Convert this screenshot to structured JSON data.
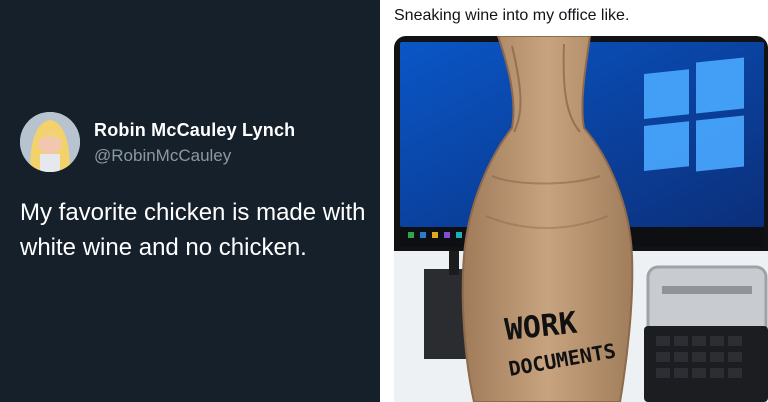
{
  "left_tweet": {
    "author_name": "Robin McCauley Lynch",
    "author_handle": "@RobinMcCauley",
    "text": "My favorite chicken is made with white wine and no chicken."
  },
  "right_tweet": {
    "caption": "Sneaking wine into my office like.",
    "bag_text_line1": "WORK",
    "bag_text_line2": "DOCUMENTS"
  },
  "colors": {
    "left_bg": "#15202b",
    "left_text": "#ffffff",
    "handle_text": "#8b98a5",
    "right_bg": "#ffffff",
    "windows_blue": "#0a74da"
  },
  "icons": {
    "avatar": "avatar-image",
    "photo": "wine-bag-photo"
  }
}
